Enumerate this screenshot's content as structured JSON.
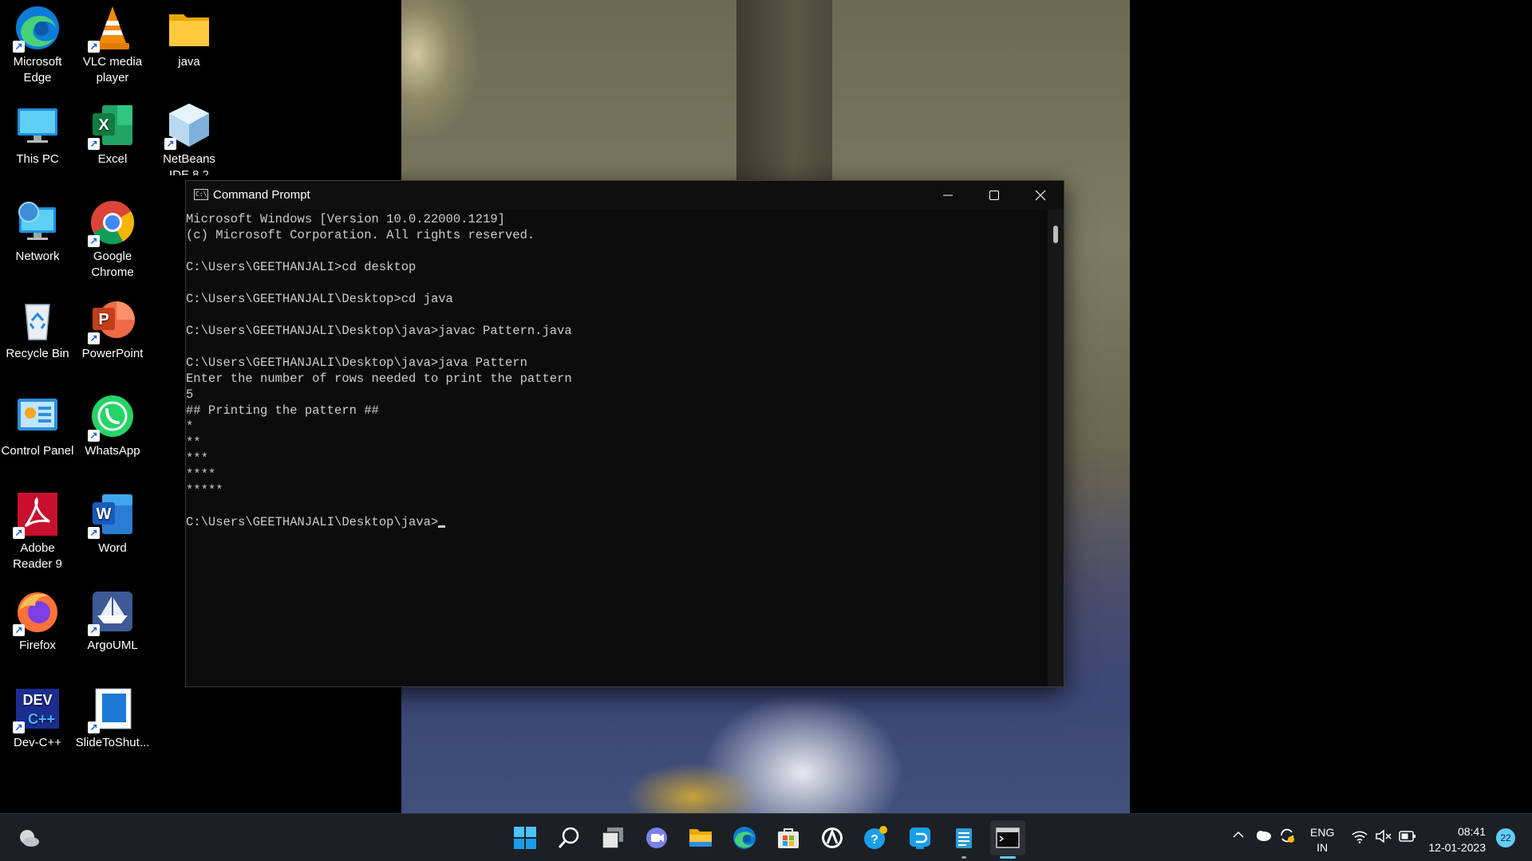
{
  "desktop": {
    "icons": [
      {
        "label": "Microsoft Edge"
      },
      {
        "label": "VLC media player"
      },
      {
        "label": "java"
      },
      {
        "label": "This PC"
      },
      {
        "label": "Excel"
      },
      {
        "label": "NetBeans IDE 8.2"
      },
      {
        "label": "Network"
      },
      {
        "label": "Google Chrome"
      },
      {
        "label": "Recycle Bin"
      },
      {
        "label": "PowerPoint"
      },
      {
        "label": "Control Panel"
      },
      {
        "label": "WhatsApp"
      },
      {
        "label": "Adobe Reader 9"
      },
      {
        "label": "Word"
      },
      {
        "label": "Firefox"
      },
      {
        "label": "ArgoUML"
      },
      {
        "label": "Dev-C++"
      },
      {
        "label": "SlideToShut..."
      }
    ]
  },
  "window": {
    "title": "Command Prompt",
    "icon": "cmd-icon",
    "controls": [
      "minimize-icon",
      "maximize-icon",
      "close-icon"
    ],
    "console_lines": [
      "Microsoft Windows [Version 10.0.22000.1219]",
      "(c) Microsoft Corporation. All rights reserved.",
      "",
      "C:\\Users\\GEETHANJALI>cd desktop",
      "",
      "C:\\Users\\GEETHANJALI\\Desktop>cd java",
      "",
      "C:\\Users\\GEETHANJALI\\Desktop\\java>javac Pattern.java",
      "",
      "C:\\Users\\GEETHANJALI\\Desktop\\java>java Pattern",
      "Enter the number of rows needed to print the pattern",
      "5",
      "## Printing the pattern ##",
      "*",
      "**",
      "***",
      "****",
      "*****",
      ""
    ],
    "prompt": "C:\\Users\\GEETHANJALI\\Desktop\\java>"
  },
  "taskbar": {
    "icons": [
      "weather-icon",
      "start-icon",
      "search-icon",
      "task-view-icon",
      "teams-chat-icon",
      "file-explorer-icon",
      "edge-icon",
      "store-icon",
      "app-icon",
      "help-icon",
      "remote-icon",
      "notepad-icon",
      "terminal-icon"
    ],
    "tray": {
      "language_line1": "ENG",
      "language_line2": "IN",
      "time": "08:41",
      "date": "12-01-2023",
      "notification_count": "22"
    }
  },
  "colors": {
    "console_bg": "#0c0c0c",
    "console_text": "#cccccc",
    "taskbar_bg": "#1c1f24",
    "accent": "#60cdff"
  }
}
